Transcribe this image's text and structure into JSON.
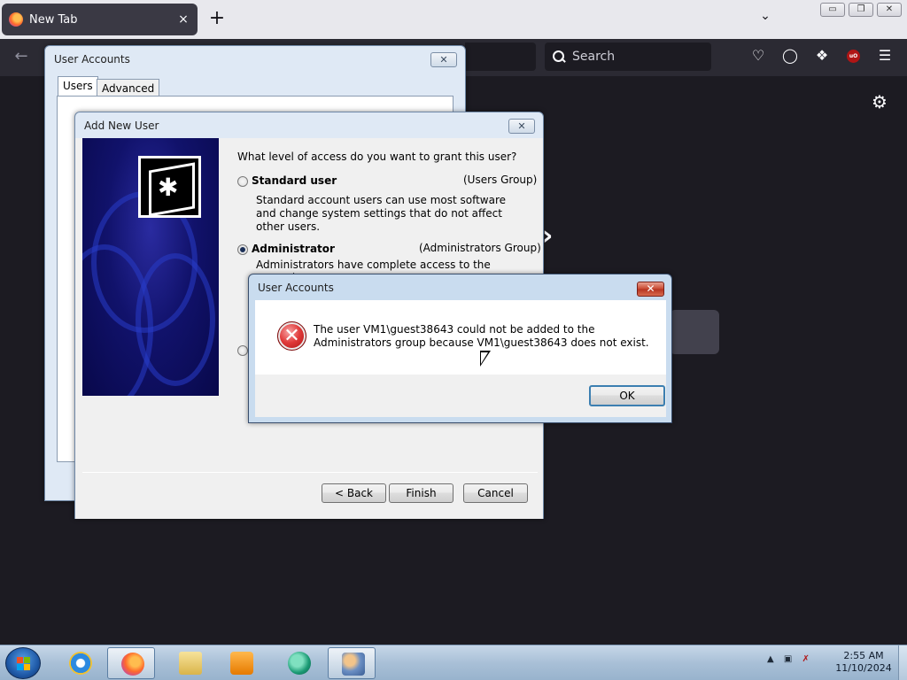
{
  "browser": {
    "tab_title": "New Tab",
    "tab_close": "×",
    "new_tab": "+",
    "list_tabs": "⌄",
    "back": "←",
    "search_placeholder": "Search",
    "ublock_label": "uO",
    "window_buttons": {
      "minimize": "▭",
      "restore": "❐",
      "close": "✕"
    }
  },
  "user_accounts": {
    "title": "User Accounts",
    "tabs": [
      "Users",
      "Advanced"
    ]
  },
  "add_new_user": {
    "title": "Add New User",
    "question": "What level of access do you want to grant this user?",
    "options": [
      {
        "label": "Standard user",
        "group": "(Users Group)",
        "description": "Standard account users can use most software and change system settings that do not affect other users.",
        "selected": false
      },
      {
        "label": "Administrator",
        "group": "(Administrators Group)",
        "description": "Administrators have complete access to the computer",
        "selected": true
      }
    ],
    "buttons": {
      "back": "< Back",
      "finish": "Finish",
      "cancel": "Cancel"
    }
  },
  "error_dialog": {
    "title": "User Accounts",
    "message": "The user VM1\\guest38643 could not be added to the Administrators group because VM1\\guest38643 does not exist.",
    "ok": "OK",
    "icon": "error-icon"
  },
  "taskbar": {
    "apps": [
      "internet-explorer",
      "firefox",
      "file-explorer",
      "media-player",
      "app",
      "user-accounts"
    ],
    "time": "2:55 AM",
    "date": "11/10/2024"
  },
  "colors": {
    "firefox_bg": "#1c1b22",
    "toolbar": "#2b2a33",
    "accent": "#3c7fb1",
    "error_red": "#c8472f"
  }
}
